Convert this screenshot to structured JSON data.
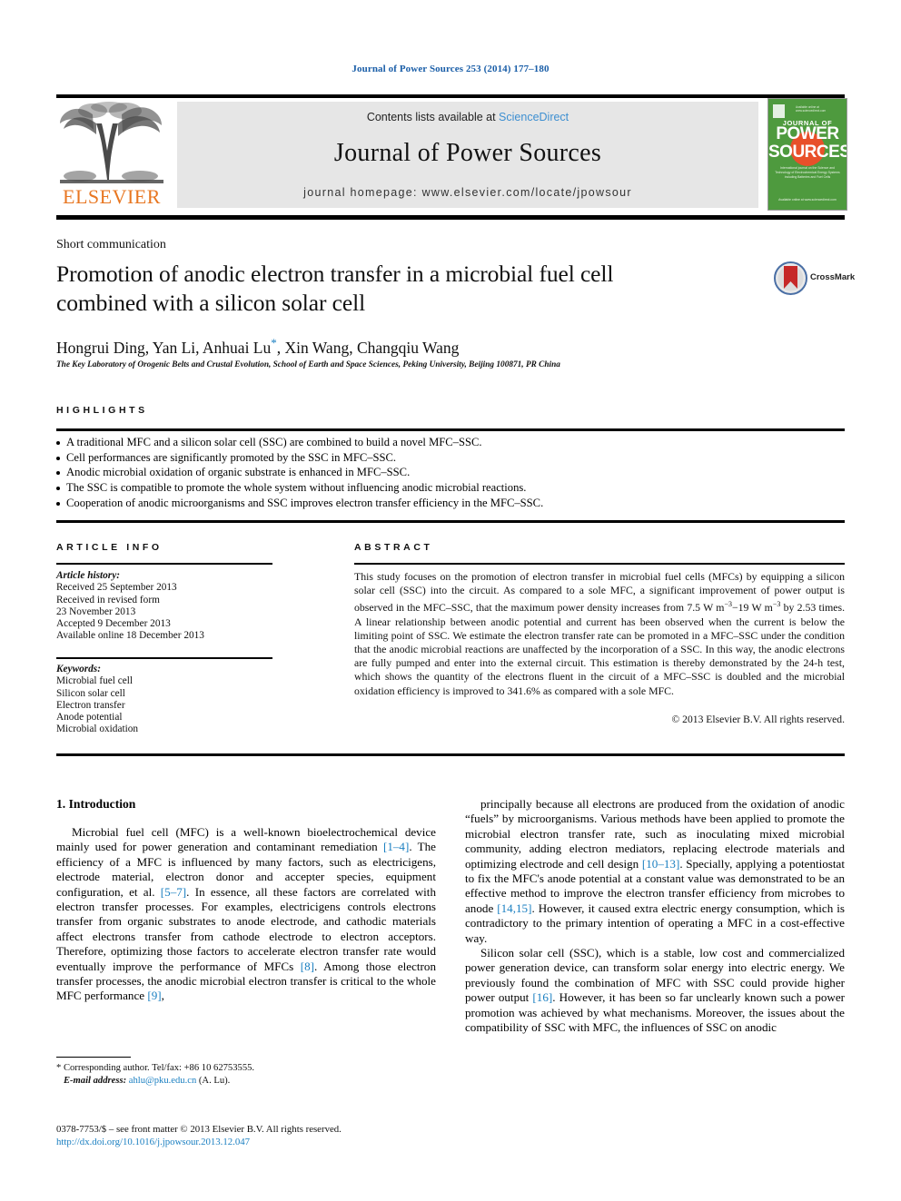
{
  "running_head": "Journal of Power Sources 253 (2014) 177–180",
  "masthead": {
    "contents_prefix": "Contents lists available at ",
    "sciencedirect": "ScienceDirect",
    "journal_title": "Journal of Power Sources",
    "homepage": "journal homepage: www.elsevier.com/locate/jpowsour",
    "publisher_logo_text": "ELSEVIER",
    "cover": {
      "journal_of": "JOURNAL OF",
      "power": "POWER",
      "sources": "SOURCES",
      "blurb": "International journal on the Science and Technology of Electrochemical Energy Systems including Batteries and Fuel Cells",
      "foot": "Available online at www.sciencedirect.com"
    },
    "accent_orange": "#E87722",
    "accent_blue": "#3d8fd1",
    "cover_green": "#4e9a3e"
  },
  "article": {
    "section_type": "Short communication",
    "title": "Promotion of anodic electron transfer in a microbial fuel cell combined with a silicon solar cell",
    "authors": "Hongrui Ding, Yan Li, Anhuai Lu",
    "authors_rest": ", Xin Wang, Changqiu Wang",
    "corresponding_marker": "*",
    "affiliation": "The Key Laboratory of Orogenic Belts and Crustal Evolution, School of Earth and Space Sciences, Peking University, Beijing 100871, PR China",
    "crossmark_label": "CrossMark"
  },
  "highlights": {
    "heading": "HIGHLIGHTS",
    "items": [
      "A traditional MFC and a silicon solar cell (SSC) are combined to build a novel MFC–SSC.",
      "Cell performances are significantly promoted by the SSC in MFC–SSC.",
      "Anodic microbial oxidation of organic substrate is enhanced in MFC–SSC.",
      "The SSC is compatible to promote the whole system without influencing anodic microbial reactions.",
      "Cooperation of anodic microorganisms and SSC improves electron transfer efficiency in the MFC–SSC."
    ]
  },
  "article_info": {
    "heading": "ARTICLE INFO",
    "history_label": "Article history:",
    "history": [
      "Received 25 September 2013",
      "Received in revised form",
      "23 November 2013",
      "Accepted 9 December 2013",
      "Available online 18 December 2013"
    ],
    "keywords_label": "Keywords:",
    "keywords": [
      "Microbial fuel cell",
      "Silicon solar cell",
      "Electron transfer",
      "Anode potential",
      "Microbial oxidation"
    ]
  },
  "abstract": {
    "heading": "ABSTRACT",
    "part1": "This study focuses on the promotion of electron transfer in microbial fuel cells (MFCs) by equipping a silicon solar cell (SSC) into the circuit. As compared to a sole MFC, a significant improvement of power output is observed in the MFC–SSC, that the maximum power density increases from 7.5 W m",
    "sup1": "−3",
    "part2": "−19 W m",
    "sup2": "−3",
    "part3": " by 2.53 times. A linear relationship between anodic potential and current has been observed when the current is below the limiting point of SSC. We estimate the electron transfer rate can be promoted in a MFC–SSC under the condition that the anodic microbial reactions are unaffected by the incorporation of a SSC. In this way, the anodic electrons are fully pumped and enter into the external circuit. This estimation is thereby demonstrated by the 24-h test, which shows the quantity of the electrons fluent in the circuit of a MFC–SSC is doubled and the microbial oxidation efficiency is improved to 341.6% as compared with a sole MFC.",
    "copyright": "© 2013 Elsevier B.V. All rights reserved."
  },
  "body": {
    "intro_heading": "1. Introduction",
    "left_p1_a": "Microbial fuel cell (MFC) is a well-known bioelectrochemical device mainly used for power generation and contaminant remediation ",
    "left_p1_r1": "[1–4]",
    "left_p1_b": ". The efficiency of a MFC is influenced by many factors, such as electricigens, electrode material, electron donor and accepter species, equipment configuration, et al. ",
    "left_p1_r2": "[5–7]",
    "left_p1_c": ". In essence, all these factors are correlated with electron transfer processes. For examples, electricigens controls electrons transfer from organic substrates to anode electrode, and cathodic materials affect electrons transfer from cathode electrode to electron acceptors. Therefore, optimizing those factors to accelerate electron transfer rate would eventually improve the performance of MFCs ",
    "left_p1_r3": "[8]",
    "left_p1_d": ". Among those electron transfer processes, the anodic microbial electron transfer is critical to the whole MFC performance ",
    "left_p1_r4": "[9]",
    "left_p1_e": ",",
    "right_p1_a": "principally because all electrons are produced from the oxidation of anodic “fuels” by microorganisms. Various methods have been applied to promote the microbial electron transfer rate, such as inoculating mixed microbial community, adding electron mediators, replacing electrode materials and optimizing electrode and cell design ",
    "right_p1_r1": "[10–13]",
    "right_p1_b": ". Specially, applying a potentiostat to fix the MFC's anode potential at a constant value was demonstrated to be an effective method to improve the electron transfer efficiency from microbes to anode ",
    "right_p1_r2": "[14,15]",
    "right_p1_c": ". However, it caused extra electric energy consumption, which is contradictory to the primary intention of operating a MFC in a cost-effective way.",
    "right_p2_a": "Silicon solar cell (SSC), which is a stable, low cost and commercialized power generation device, can transform solar energy into electric energy. We previously found the combination of MFC with SSC could provide higher power output ",
    "right_p2_r1": "[16]",
    "right_p2_b": ". However, it has been so far unclearly known such a power promotion was achieved by what mechanisms. Moreover, the issues about the compatibility of SSC with MFC, the influences of SSC on anodic"
  },
  "footnote": {
    "corresponding": "* Corresponding author. Tel/fax: +86 10 62753555.",
    "email_label": "E-mail address:",
    "email": "ahlu@pku.edu.cn",
    "email_suffix": "(A. Lu)."
  },
  "frontmatter": {
    "issn_line": "0378-7753/$ – see front matter © 2013 Elsevier B.V. All rights reserved.",
    "doi": "http://dx.doi.org/10.1016/j.jpowsour.2013.12.047"
  }
}
